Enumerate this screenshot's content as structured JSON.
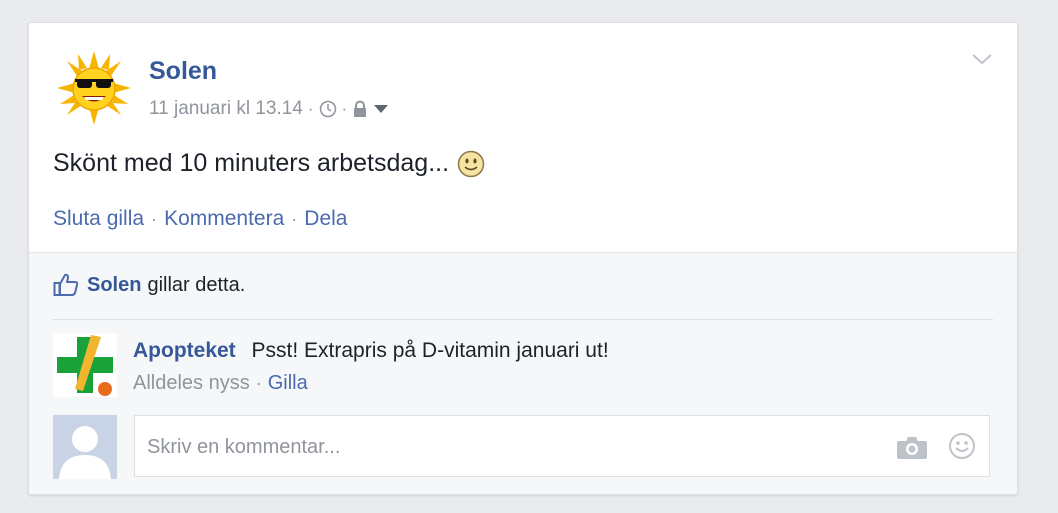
{
  "post": {
    "author": "Solen",
    "timestamp": "11 januari kl 13.14",
    "separator": "·",
    "text": "Skönt med 10 minuters arbetsdag...",
    "avatar_icon": "sun-with-sunglasses-icon",
    "privacy_icon": "lock-icon",
    "time_icon": "clock-icon",
    "menu_icon": "chevron-down-icon"
  },
  "actions": {
    "unlike": "Sluta gilla",
    "comment": "Kommentera",
    "share": "Dela",
    "separator": "·"
  },
  "likes": {
    "name": "Solen",
    "text": "gillar detta."
  },
  "comments": [
    {
      "author": "Apopteket",
      "text": "Psst! Extrapris på D-vitamin januari ut!",
      "time": "Alldeles nyss",
      "like": "Gilla",
      "separator": "·",
      "avatar_icon": "pharmacy-cross-icon"
    }
  ],
  "composer": {
    "placeholder": "Skriv en kommentar...",
    "camera_icon": "camera-icon",
    "emoji_icon": "smiley-icon"
  },
  "colors": {
    "link": "#365899",
    "action": "#4b6bad",
    "muted": "#90949c",
    "background": "#e9ebee"
  }
}
